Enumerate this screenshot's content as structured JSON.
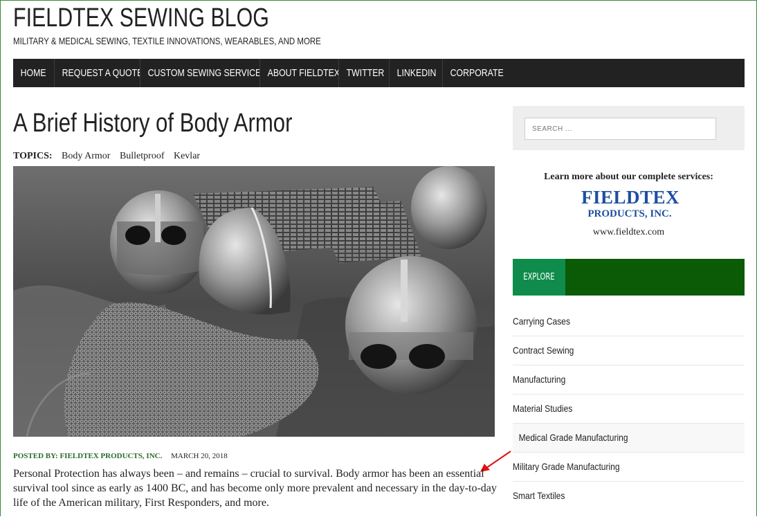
{
  "site": {
    "title": "FIELDTEX SEWING BLOG",
    "tagline": "MILITARY & MEDICAL SEWING, TEXTILE INNOVATIONS, WEARABLES, AND MORE"
  },
  "nav": {
    "items": [
      {
        "label": "HOME"
      },
      {
        "label": "REQUEST A QUOTE"
      },
      {
        "label": "CUSTOM SEWING SERVICES"
      },
      {
        "label": "ABOUT FIELDTEX"
      },
      {
        "label": "TWITTER"
      },
      {
        "label": "LINKEDIN"
      },
      {
        "label": "CORPORATE"
      }
    ]
  },
  "post": {
    "title": "A Brief History of Body Armor",
    "topics_label": "TOPICS:",
    "topics": [
      "Body Armor",
      "Bulletproof",
      "Kevlar"
    ],
    "posted_by": "POSTED BY: FIELDTEX PRODUCTS, INC.",
    "date": "MARCH 20, 2018",
    "body": "Personal Protection has always been – and remains – crucial to survival. Body armor has been an essential survival tool since as early as 1400 BC, and has become only more prevalent and necessary in the day-to-day life of the American military, First Responders, and more."
  },
  "sidebar": {
    "search_placeholder": "SEARCH ...",
    "promo_heading": "Learn more about our complete services:",
    "logo_line1": "FIELDTEX",
    "logo_line2": "PRODUCTS, INC.",
    "promo_url": "www.fieldtex.com",
    "explore_label": "EXPLORE",
    "categories": [
      {
        "label": "Carrying Cases",
        "child": false
      },
      {
        "label": "Contract Sewing",
        "child": false
      },
      {
        "label": "Manufacturing",
        "child": false
      },
      {
        "label": "Material Studies",
        "child": false
      },
      {
        "label": "Medical Grade Manufacturing",
        "child": true
      },
      {
        "label": "Military Grade Manufacturing",
        "child": false
      },
      {
        "label": "Smart Textiles",
        "child": false
      }
    ]
  },
  "colors": {
    "nav_bg": "#222222",
    "explore_tab": "#0f8c4c",
    "explore_bar": "#0b5a06",
    "byline": "#2a6b2a",
    "logo": "#1e4fa0",
    "annotation_arrow": "#e01010"
  }
}
